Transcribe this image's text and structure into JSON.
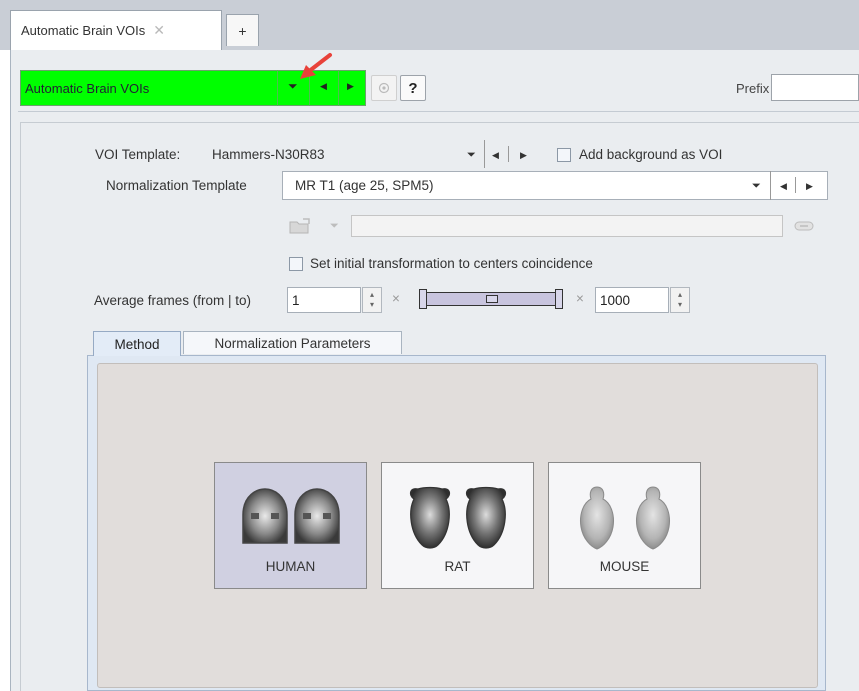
{
  "tabs": {
    "document_tab_label": "Automatic Brain VOIs",
    "close_glyph": "✕",
    "add_glyph": "+"
  },
  "toolbar": {
    "title": "Automatic Brain VOIs",
    "dropdown_glyph": "⏷",
    "prev_glyph": "◀",
    "next_glyph": "▶",
    "help_label": "?",
    "prefix_label": "Prefix",
    "prefix_value": "",
    "accent_color": "#00ff00",
    "annotation_arrow_color": "#e8423a"
  },
  "voi": {
    "template_label": "VOI Template:",
    "template_value": "Hammers-N30R83",
    "add_background_label": "Add background as VOI",
    "add_background_checked": false
  },
  "normalization": {
    "label": "Normalization Template",
    "value": "MR T1 (age 25, SPM5)",
    "path_value": "",
    "center_label": "Set initial transformation to centers coincidence",
    "center_checked": false
  },
  "frames": {
    "label": "Average frames (from | to)",
    "from_value": "1",
    "to_value": "1000",
    "times_glyph": "×"
  },
  "method_tabs": {
    "method": "Method",
    "normalization_parameters": "Normalization Parameters"
  },
  "species": [
    {
      "label": "HUMAN",
      "selected": true,
      "icon": "human-brain-icon"
    },
    {
      "label": "RAT",
      "selected": false,
      "icon": "rat-brain-icon"
    },
    {
      "label": "MOUSE",
      "selected": false,
      "icon": "mouse-brain-icon"
    }
  ]
}
